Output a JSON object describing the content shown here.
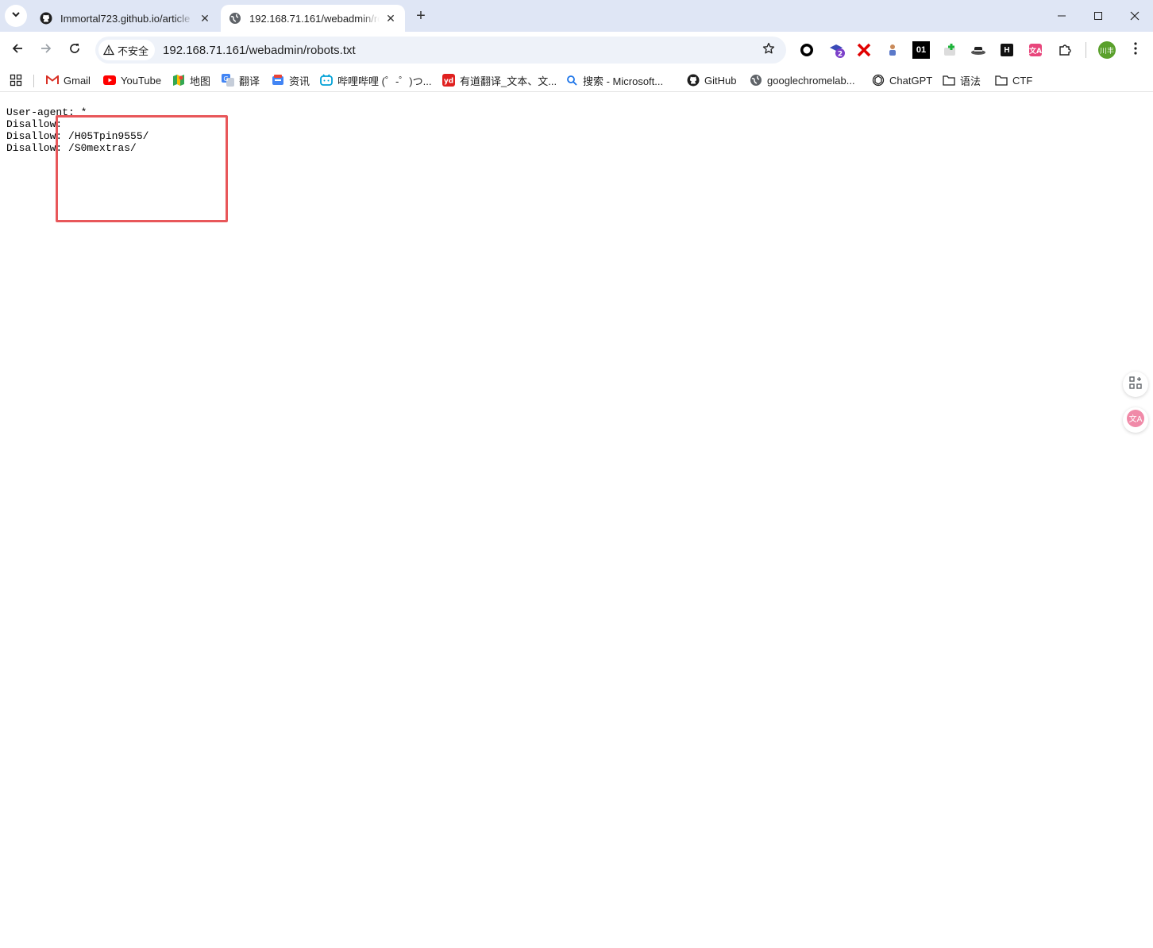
{
  "tabs": [
    {
      "title": "Immortal723.github.io/article",
      "icon": "github-icon",
      "active": false
    },
    {
      "title": "192.168.71.161/webadmin/robots.txt",
      "icon": "globe-icon",
      "active": true
    }
  ],
  "tab_close_glyph": "✕",
  "new_tab_glyph": "+",
  "omnibox": {
    "security_label": "不安全",
    "url": "192.168.71.161/webadmin/robots.txt"
  },
  "extensions": [
    {
      "name": "circle-extension-icon",
      "label": ""
    },
    {
      "name": "graduation-extension-icon",
      "label": "2"
    },
    {
      "name": "x-extension-icon",
      "label": ""
    },
    {
      "name": "figure-extension-icon",
      "label": ""
    },
    {
      "name": "binary-extension-icon",
      "label": "01"
    },
    {
      "name": "plus-extension-icon",
      "label": ""
    },
    {
      "name": "hat-extension-icon",
      "label": ""
    },
    {
      "name": "h-extension-icon",
      "label": "H"
    },
    {
      "name": "translate-extension-icon",
      "label": ""
    },
    {
      "name": "puzzle-extension-icon",
      "label": ""
    }
  ],
  "profile": {
    "label": "川丰"
  },
  "bookmarks": [
    {
      "label": "Gmail",
      "icon": "gmail-icon"
    },
    {
      "label": "YouTube",
      "icon": "youtube-icon"
    },
    {
      "label": "地图",
      "icon": "maps-icon"
    },
    {
      "label": "翻译",
      "icon": "translate-icon"
    },
    {
      "label": "资讯",
      "icon": "news-icon"
    },
    {
      "label": "哔哩哔哩 (゜-゜)つ...",
      "icon": "bilibili-icon"
    },
    {
      "label": "有道翻译_文本、文...",
      "icon": "youdao-icon"
    },
    {
      "label": "搜索 - Microsoft...",
      "icon": "search-icon"
    },
    {
      "label": "GitHub",
      "icon": "github-icon"
    },
    {
      "label": "googlechromelab...",
      "icon": "globe-icon"
    },
    {
      "label": "ChatGPT",
      "icon": "chatgpt-icon"
    },
    {
      "label": "语法",
      "icon": "folder-icon"
    },
    {
      "label": "CTF",
      "icon": "folder-icon"
    }
  ],
  "robots": {
    "lines": [
      "User-agent: *",
      "Disallow:",
      "Disallow: /H05Tpin9555/",
      "Disallow: /S0mextras/"
    ]
  },
  "colors": {
    "tabstrip_bg": "#dfe6f5",
    "omnibox_bg": "#eef2f9",
    "highlight_border": "#e8575a"
  }
}
